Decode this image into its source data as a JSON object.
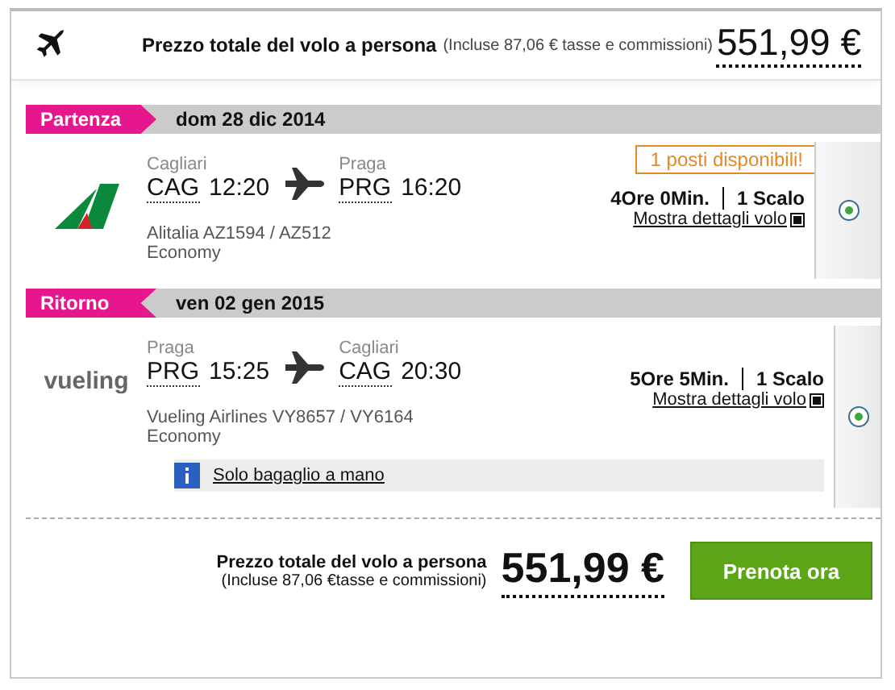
{
  "header": {
    "title": "Prezzo totale del volo a persona",
    "taxes": "(Incluse 87,06 € tasse e commissioni)",
    "price": "551,99 €"
  },
  "legs": [
    {
      "kind": "outbound",
      "label": "Partenza",
      "date": "dom 28 dic 2014",
      "logo": {
        "kind": "mark"
      },
      "from": {
        "city": "Cagliari",
        "code": "CAG",
        "time": "12:20"
      },
      "to": {
        "city": "Praga",
        "code": "PRG",
        "time": "16:20"
      },
      "duration": "4Ore 0Min.",
      "stops": "1 Scalo",
      "details_link": "Mostra dettagli volo",
      "carrier": "Alitalia AZ1594 / AZ512",
      "cabin": "Economy",
      "seats_notice": "1 posti disponibili!",
      "selected": true
    },
    {
      "kind": "return",
      "label": "Ritorno",
      "date": "ven 02 gen 2015",
      "logo": {
        "kind": "wordmark",
        "text": "vueling"
      },
      "from": {
        "city": "Praga",
        "code": "PRG",
        "time": "15:25"
      },
      "to": {
        "city": "Cagliari",
        "code": "CAG",
        "time": "20:30"
      },
      "duration": "5Ore 5Min.",
      "stops": "1 Scalo",
      "details_link": "Mostra dettagli volo",
      "carrier": "Vueling Airlines VY8657 / VY6164",
      "cabin": "Economy",
      "baggage_note": "Solo bagaglio a mano",
      "selected": true
    }
  ],
  "footer": {
    "title": "Prezzo totale del volo a persona",
    "taxes": "(Incluse 87,06 €tasse e commissioni)",
    "price": "551,99 €",
    "button": "Prenota ora"
  }
}
